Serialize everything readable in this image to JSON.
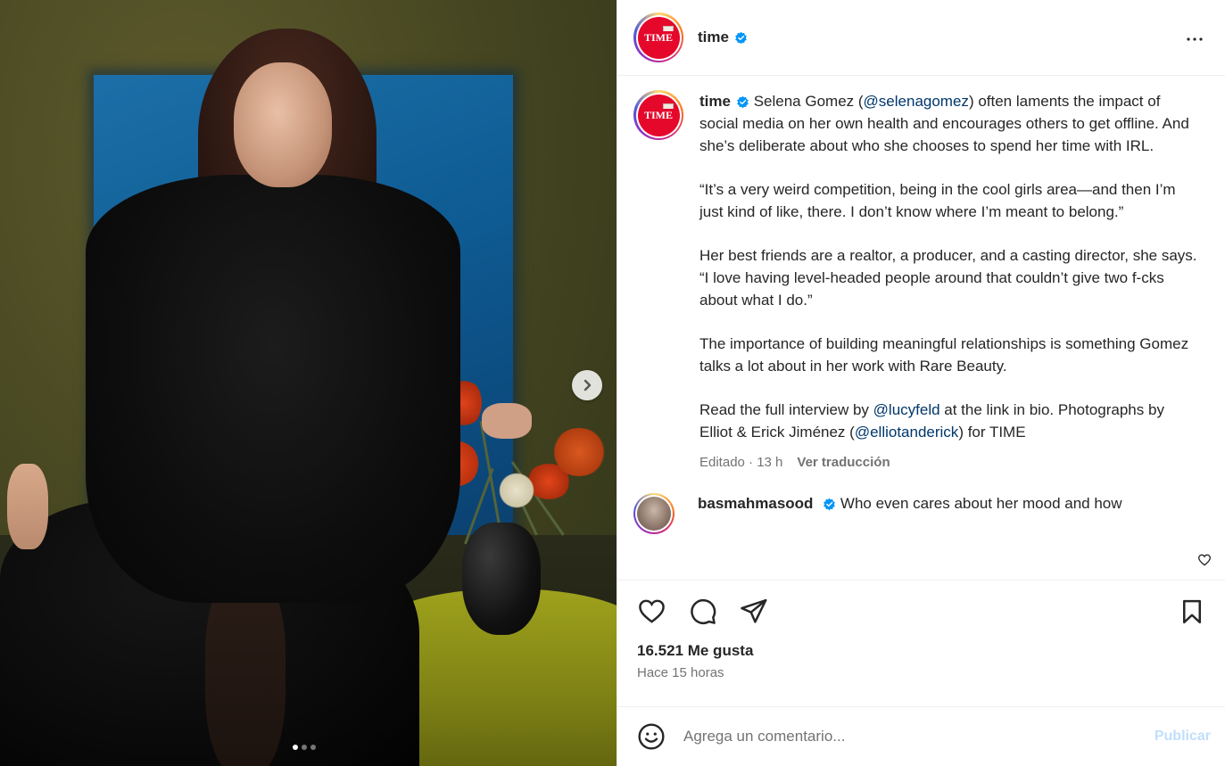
{
  "post": {
    "carousel": {
      "total_slides": 3,
      "active_slide": 1
    },
    "image_alt": "Selena Gomez portrait"
  },
  "header": {
    "username": "time",
    "avatar_text": "TIME",
    "verified": true
  },
  "caption": {
    "username": "time",
    "paragraphs": [
      [
        {
          "text": "Selena Gomez ("
        },
        {
          "text": "@selenagomez",
          "mention": true
        },
        {
          "text": ") often laments the impact of social media on her own health and encourages others to get offline. And she’s deliberate about who she chooses to spend her time with IRL."
        }
      ],
      [
        {
          "text": "“It’s a very weird competition, being in the cool girls area—and then I’m just kind of like, there. I don’t know where I’m meant to belong.”"
        }
      ],
      [
        {
          "text": "Her best friends are a realtor, a producer, and a casting director, she says. “I love having level-headed people around that couldn’t give two f-cks about what I do.”"
        }
      ],
      [
        {
          "text": "The importance of building meaningful relationships is something Gomez talks a lot about in her work with Rare Beauty."
        }
      ],
      [
        {
          "text": "Read the full interview by "
        },
        {
          "text": "@lucyfeld",
          "mention": true
        },
        {
          "text": " at the link in bio. Photographs by Elliot & Erick Jiménez ("
        },
        {
          "text": "@elliotanderick",
          "mention": true
        },
        {
          "text": ") for TIME"
        }
      ]
    ],
    "meta_edited": "Editado · 13 h",
    "translate_label": "Ver traducción"
  },
  "comment": {
    "username": "basmahmasood",
    "verified": true,
    "text": "Who even cares about her mood and how"
  },
  "actions": {
    "likes": "16.521 Me gusta",
    "time_ago": "Hace 15 horas"
  },
  "add_comment": {
    "placeholder": "Agrega un comentario...",
    "publish_label": "Publicar"
  },
  "colors": {
    "verified": "#0095f6",
    "mention": "#00376b",
    "time_red": "#e5082b",
    "publish_disabled": "#c0dffd"
  },
  "icons": {
    "more": "more-horizontal-icon",
    "like": "heart-icon",
    "comment": "comment-icon",
    "share": "paper-plane-icon",
    "save": "bookmark-icon",
    "emoji": "emoji-icon",
    "next": "chevron-right-icon"
  }
}
